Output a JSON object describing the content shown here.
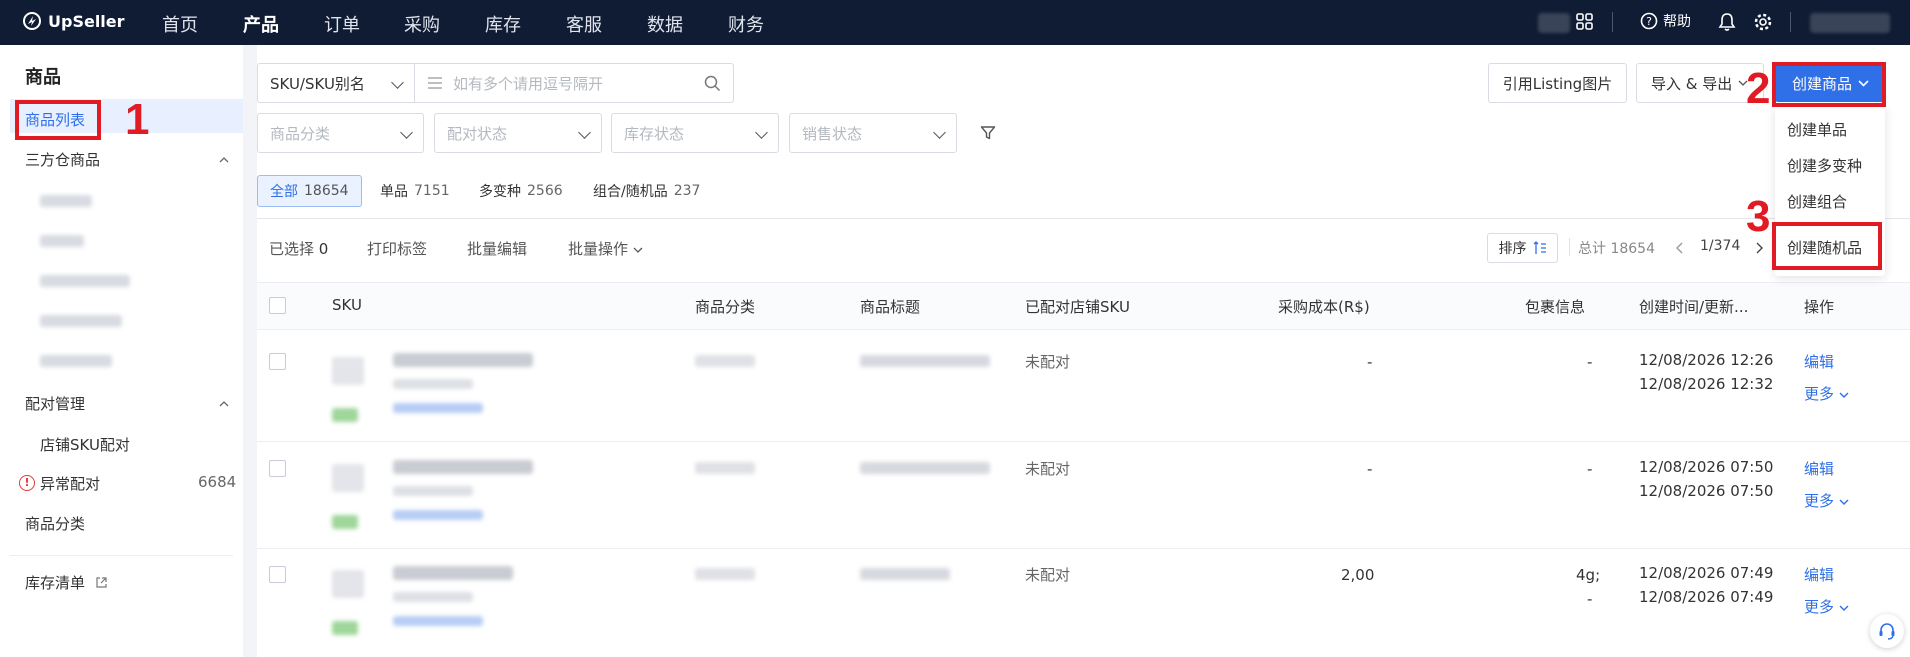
{
  "brand": {
    "name": "UpSeller"
  },
  "nav": {
    "items": [
      "首页",
      "产品",
      "订单",
      "采购",
      "库存",
      "客服",
      "数据",
      "财务"
    ],
    "active_index": 1,
    "help_label": "帮助"
  },
  "sidebar": {
    "title": "商品",
    "product_list": "商品列表",
    "third_party": "三方仓商品",
    "match_mgmt": "配对管理",
    "store_sku_match": "店铺SKU配对",
    "abnormal_match": "异常配对",
    "abnormal_count": "6684",
    "category": "商品分类",
    "inventory_list": "库存清单"
  },
  "filters": {
    "sku_type": "SKU/SKU别名",
    "search_placeholder": "如有多个请用逗号隔开",
    "category_ph": "商品分类",
    "match_status_ph": "配对状态",
    "stock_status_ph": "库存状态",
    "sale_status_ph": "销售状态"
  },
  "actions": {
    "listing_images": "引用Listing图片",
    "import_export": "导入 & 导出",
    "create_product": "创建商品"
  },
  "dropdown": {
    "items": [
      "创建单品",
      "创建多变种",
      "创建组合",
      "创建随机品"
    ]
  },
  "tabs": [
    {
      "label": "全部",
      "count": "18654"
    },
    {
      "label": "单品",
      "count": "7151"
    },
    {
      "label": "多变种",
      "count": "2566"
    },
    {
      "label": "组合/随机品",
      "count": "237"
    }
  ],
  "toolbar": {
    "selected_label": "已选择",
    "selected_count": "0",
    "print_labels": "打印标签",
    "bulk_edit": "批量编辑",
    "bulk_ops": "批量操作",
    "sort": "排序",
    "total": "总计 18654",
    "page": "1/374"
  },
  "table": {
    "headers": {
      "sku": "SKU",
      "category": "商品分类",
      "title": "商品标题",
      "matched_sku": "已配对店铺SKU",
      "cost": "采购成本(R$)",
      "package": "包裹信息",
      "time": "创建时间/更新...",
      "ops": "操作"
    },
    "rows": [
      {
        "matched": "未配对",
        "cost": "-",
        "pkg1": "-",
        "pkg2": "",
        "created": "12/08/2026 12:26",
        "updated": "12/08/2026 12:32"
      },
      {
        "matched": "未配对",
        "cost": "-",
        "pkg1": "-",
        "pkg2": "",
        "created": "12/08/2026 07:50",
        "updated": "12/08/2026 07:50"
      },
      {
        "matched": "未配对",
        "cost": "2,00",
        "pkg1": "4g;",
        "pkg2": "-",
        "created": "12/08/2026 07:49",
        "updated": "12/08/2026 07:49"
      }
    ],
    "edit_label": "编辑",
    "more_label": "更多"
  },
  "annotations": {
    "n1": "1",
    "n2": "2",
    "n3": "3"
  },
  "colors": {
    "nav_bg": "#0f1c33",
    "primary": "#2f6fe8",
    "annotation": "#e11b23"
  }
}
